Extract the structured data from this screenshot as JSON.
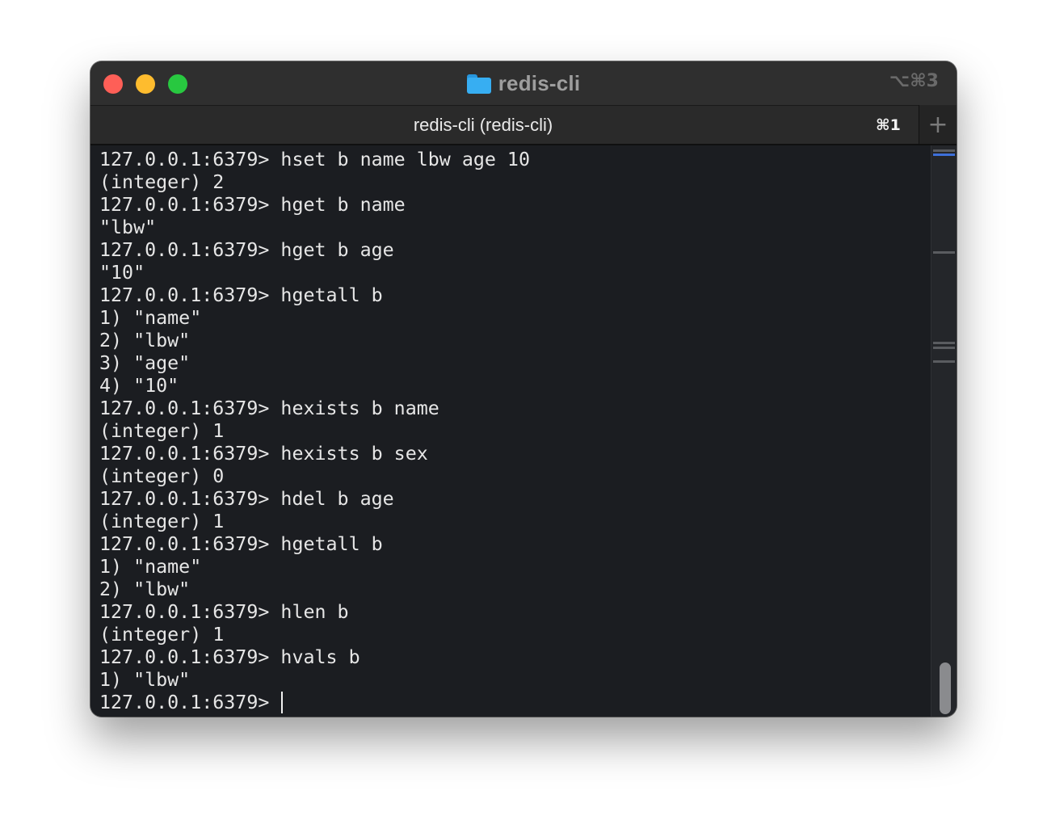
{
  "window": {
    "title": "redis-cli",
    "shortcut": "⌥⌘3"
  },
  "tabs": [
    {
      "label": "redis-cli (redis-cli)",
      "shortcut": "⌘1",
      "active": true
    }
  ],
  "new_tab_label": "+",
  "terminal": {
    "prompt": "127.0.0.1:6379> ",
    "lines": [
      "127.0.0.1:6379> hset b name lbw age 10",
      "(integer) 2",
      "127.0.0.1:6379> hget b name",
      "\"lbw\"",
      "127.0.0.1:6379> hget b age",
      "\"10\"",
      "127.0.0.1:6379> hgetall b",
      "1) \"name\"",
      "2) \"lbw\"",
      "3) \"age\"",
      "4) \"10\"",
      "127.0.0.1:6379> hexists b name",
      "(integer) 1",
      "127.0.0.1:6379> hexists b sex",
      "(integer) 0",
      "127.0.0.1:6379> hdel b age",
      "(integer) 1",
      "127.0.0.1:6379> hgetall b",
      "1) \"name\"",
      "2) \"lbw\"",
      "127.0.0.1:6379> hlen b",
      "(integer) 1",
      "127.0.0.1:6379> hvals b",
      "1) \"lbw\""
    ]
  },
  "colors": {
    "close": "#fe5f57",
    "minimize": "#febc2e",
    "maximize": "#28c840",
    "folder": "#37aef2",
    "scroll_mark_blue": "#3d6fd9",
    "scroll_mark_gray": "#5a5c60"
  }
}
